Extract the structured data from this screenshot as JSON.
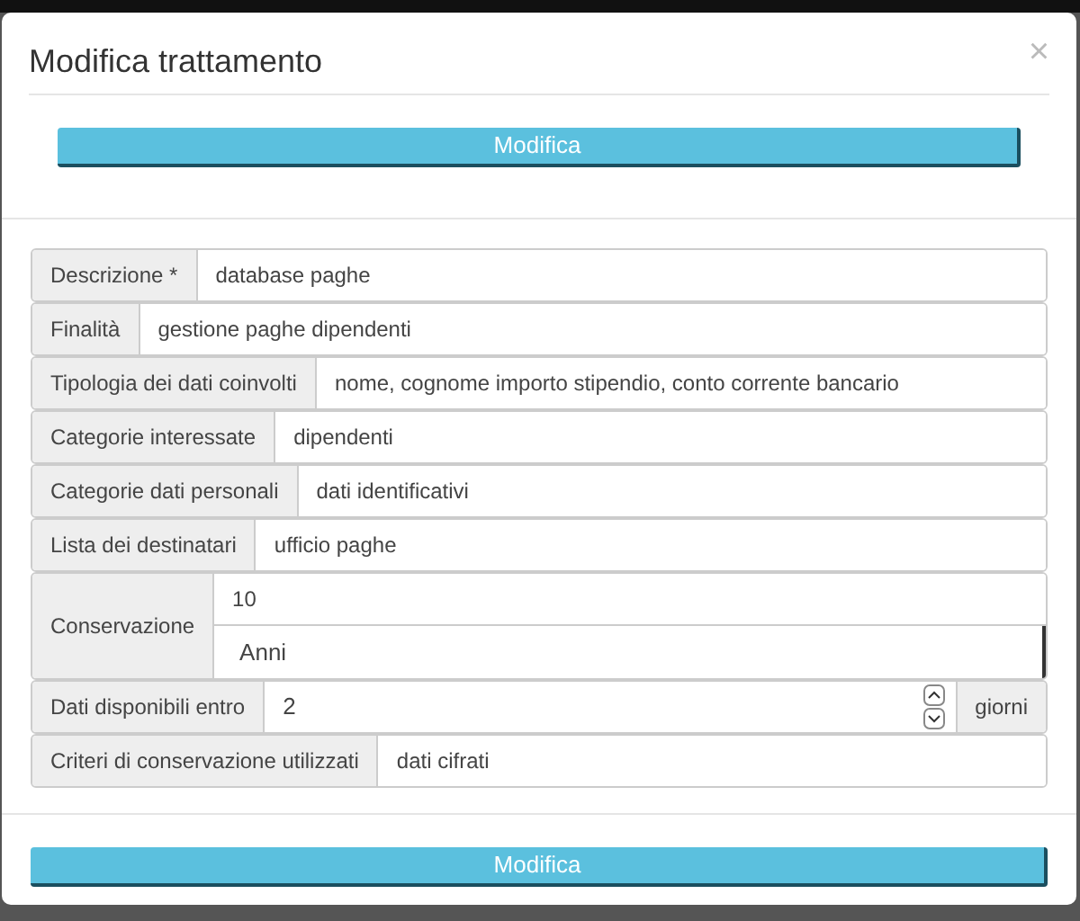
{
  "modal": {
    "title": "Modifica trattamento",
    "close": "×",
    "top_button": "Modifica",
    "bottom_button": "Modifica"
  },
  "fields": [
    {
      "kind": "text",
      "label": "Descrizione *",
      "value": "database paghe"
    },
    {
      "kind": "text",
      "label": "Finalità",
      "value": "gestione paghe dipendenti"
    },
    {
      "kind": "text",
      "label": "Tipologia dei dati coinvolti",
      "value": "nome, cognome importo stipendio, conto corrente bancario"
    },
    {
      "kind": "text",
      "label": "Categorie interessate",
      "value": "dipendenti"
    },
    {
      "kind": "text",
      "label": "Categorie dati personali",
      "value": "dati identificativi"
    },
    {
      "kind": "text",
      "label": "Lista dei destinatari",
      "value": "ufficio paghe"
    },
    {
      "kind": "duration",
      "label": "Conservazione",
      "amount": "10",
      "unit": "Anni"
    },
    {
      "kind": "number",
      "label": "Dati disponibili entro",
      "value": "2",
      "suffix": "giorni"
    },
    {
      "kind": "text",
      "label": "Criteri di conservazione utilizzati",
      "value": "dati cifrati"
    }
  ]
}
